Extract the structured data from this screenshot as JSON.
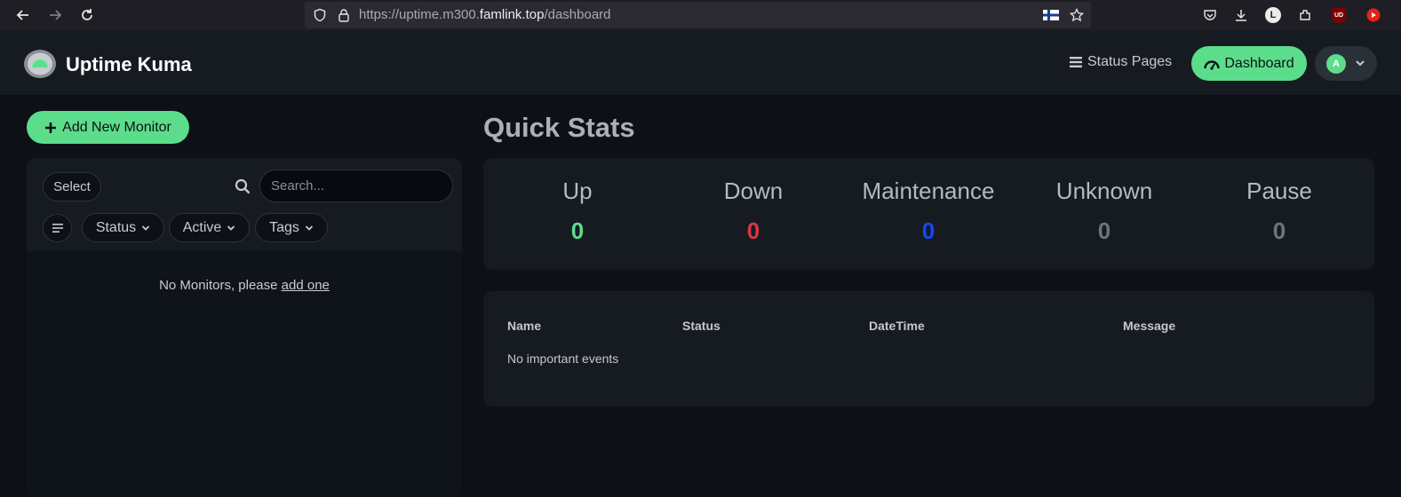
{
  "browser": {
    "url_prefix": "https://uptime.m300.",
    "url_host": "famlink.top",
    "url_path": "/dashboard",
    "profile_initial": "L",
    "ublock_label": "UD"
  },
  "header": {
    "app_title": "Uptime Kuma",
    "status_pages_label": "Status Pages",
    "dashboard_label": "Dashboard",
    "avatar_initial": "A",
    "accent_color": "#5cdd8b"
  },
  "sidebar": {
    "add_monitor_label": "Add New Monitor",
    "select_label": "Select",
    "search_placeholder": "Search...",
    "filters": [
      "Status",
      "Active",
      "Tags"
    ],
    "empty_text": "No Monitors, please",
    "empty_link": "add one"
  },
  "main": {
    "quick_stats_title": "Quick Stats",
    "stats": [
      {
        "label": "Up",
        "value": "0",
        "color": "#5cdd8b"
      },
      {
        "label": "Down",
        "value": "0",
        "color": "#dc3545"
      },
      {
        "label": "Maintenance",
        "value": "0",
        "color": "#1747f5"
      },
      {
        "label": "Unknown",
        "value": "0",
        "color": "#6c757d"
      },
      {
        "label": "Pause",
        "value": "0",
        "color": "#6c757d"
      }
    ],
    "events": {
      "columns": [
        "Name",
        "Status",
        "DateTime",
        "Message"
      ],
      "empty_text": "No important events"
    }
  }
}
